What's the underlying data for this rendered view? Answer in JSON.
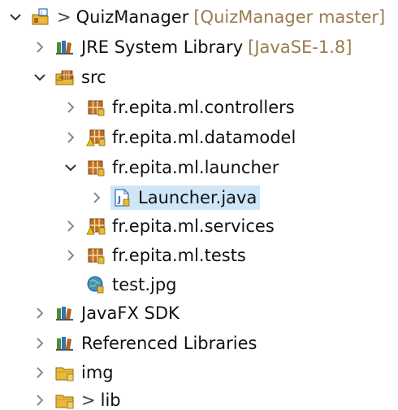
{
  "tree": {
    "project": {
      "label": "QuizManager",
      "decoration": "[QuizManager master]",
      "prefix": ">",
      "icon": "java-project-icon",
      "expanded": true
    },
    "jre": {
      "label": "JRE System Library",
      "decoration": "[JavaSE-1.8]",
      "icon": "library-icon",
      "expanded": false
    },
    "src": {
      "label": "src",
      "icon": "source-folder-icon",
      "expanded": true
    },
    "pkg_controllers": {
      "label": "fr.epita.ml.controllers",
      "icon": "package-icon",
      "expanded": false
    },
    "pkg_datamodel": {
      "label": "fr.epita.ml.datamodel",
      "icon": "package-warning-icon",
      "expanded": false
    },
    "pkg_launcher": {
      "label": "fr.epita.ml.launcher",
      "icon": "package-icon",
      "expanded": true
    },
    "launcher_java": {
      "label": "Launcher.java",
      "icon": "java-file-icon",
      "expanded": false,
      "selected": true
    },
    "pkg_services": {
      "label": "fr.epita.ml.services",
      "icon": "package-warning-icon",
      "expanded": false
    },
    "pkg_tests": {
      "label": "fr.epita.ml.tests",
      "icon": "package-icon",
      "expanded": false
    },
    "test_jpg": {
      "label": "test.jpg",
      "icon": "image-file-icon"
    },
    "javafx": {
      "label": "JavaFX SDK",
      "icon": "library-icon",
      "expanded": false
    },
    "referenced": {
      "label": "Referenced Libraries",
      "icon": "library-icon",
      "expanded": false
    },
    "img": {
      "label": "img",
      "icon": "folder-icon",
      "expanded": false
    },
    "lib": {
      "label": "lib",
      "prefix": ">",
      "icon": "folder-icon",
      "expanded": false
    }
  },
  "colors": {
    "selection": "#cfe6f8",
    "decoration": "#9a7b4f",
    "package_brown": "#b5651d",
    "folder_yellow": "#e8b93a"
  }
}
